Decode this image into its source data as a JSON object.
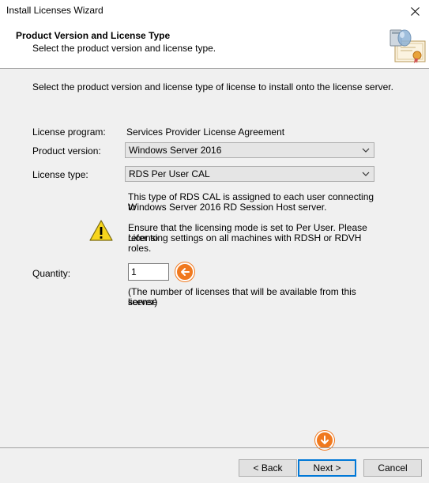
{
  "window": {
    "title": "Install Licenses Wizard"
  },
  "header": {
    "title": "Product Version and License Type",
    "subtitle": "Select the product version and license type."
  },
  "main": {
    "intro": "Select the product version and license type of license to install onto the license server.",
    "license_program": {
      "label": "License program:",
      "value": "Services Provider License Agreement"
    },
    "product_version": {
      "label": "Product version:",
      "value": "Windows Server 2016"
    },
    "license_type": {
      "label": "License type:",
      "value": "RDS Per User CAL"
    },
    "description_line1": "This type of RDS CAL is assigned to each user connecting to",
    "description_line2": "Windows Server 2016 RD Session Host server.",
    "warning_line1": "Ensure that the licensing mode is set to Per User. Please refer to",
    "warning_line2": "Licensing settings on all machines with RDSH or RDVH roles.",
    "quantity": {
      "label": "Quantity:",
      "value": "1",
      "note_line1": "(The number of licenses that will be available from this license",
      "note_line2": "server)"
    }
  },
  "footer": {
    "back_label": "< Back",
    "next_label": "Next >",
    "cancel_label": "Cancel"
  },
  "colors": {
    "marker": "#f0791f",
    "default_button_border": "#0078d7",
    "warning_fill": "#f7d51d"
  },
  "icons": [
    "close-icon",
    "certificate-icon",
    "chevron-down-icon",
    "warning-icon",
    "arrow-left-icon",
    "arrow-down-icon"
  ]
}
